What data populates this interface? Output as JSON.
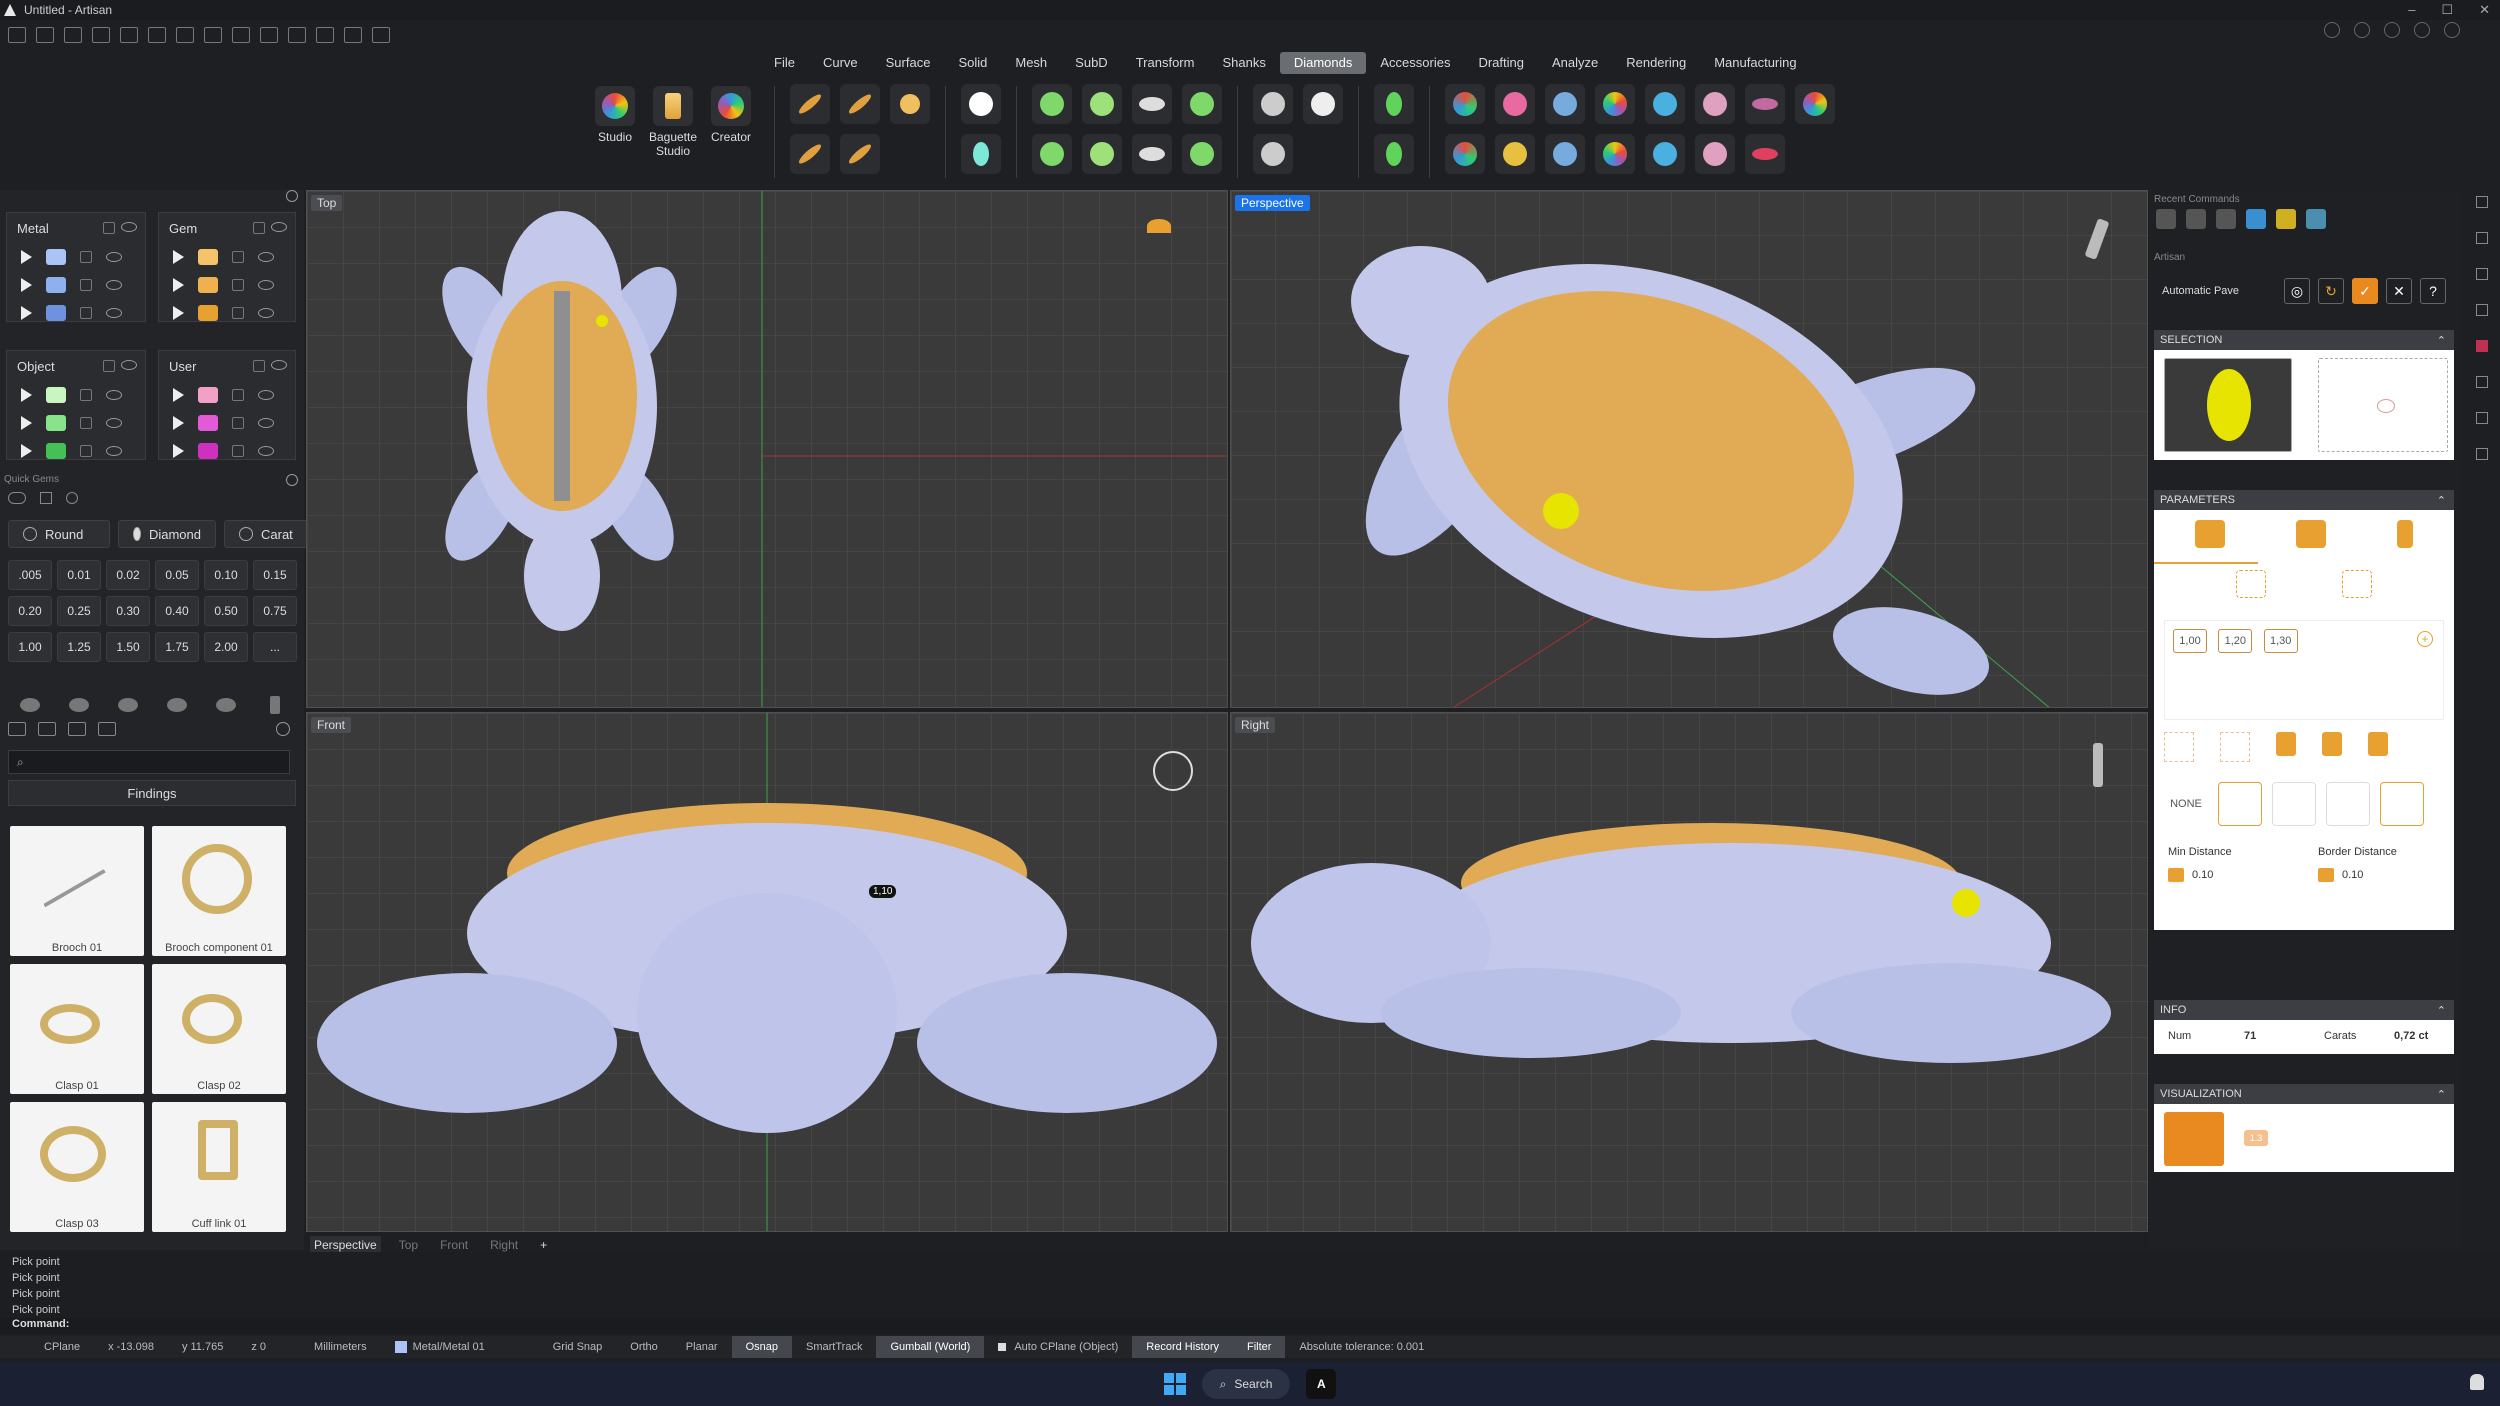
{
  "window": {
    "title": "Untitled - Artisan"
  },
  "menu": [
    "File",
    "Curve",
    "Surface",
    "Solid",
    "Mesh",
    "SubD",
    "Transform",
    "Shanks",
    "Diamonds",
    "Accessories",
    "Drafting",
    "Analyze",
    "Rendering",
    "Manufacturing"
  ],
  "menu_active": "Diamonds",
  "ribbon": {
    "studio": "Studio",
    "baguette": "Baguette Studio",
    "creator": "Creator"
  },
  "layers": {
    "metal": "Metal",
    "gem": "Gem",
    "object": "Object",
    "user": "User",
    "metal_colors": [
      "#a9c4f5",
      "#8fb0ef",
      "#6d92e0"
    ],
    "gem_colors": [
      "#f4c36a",
      "#f0b050",
      "#e8a030"
    ],
    "object_colors": [
      "#c9f5c0",
      "#88e38a",
      "#44c057"
    ],
    "user_colors": [
      "#f3a0c8",
      "#e35ad8",
      "#d030c0"
    ]
  },
  "quick_gems": {
    "title": "Quick Gems",
    "shape": "Round",
    "material": "Diamond",
    "unit": "Carat",
    "values": [
      ".005",
      "0.01",
      "0.02",
      "0.05",
      "0.10",
      "0.15",
      "0.20",
      "0.25",
      "0.30",
      "0.40",
      "0.50",
      "0.75",
      "1.00",
      "1.25",
      "1.50",
      "1.75",
      "2.00",
      "..."
    ]
  },
  "library": {
    "category": "Findings",
    "items": [
      "Brooch 01",
      "Brooch component 01",
      "Clasp 01",
      "Clasp 02",
      "Clasp 03",
      "Cuff link 01"
    ]
  },
  "viewports": {
    "top": "Top",
    "perspective": "Perspective",
    "front": "Front",
    "right": "Right"
  },
  "viewport_tabs": [
    "Perspective",
    "Top",
    "Front",
    "Right",
    "+"
  ],
  "front_label": "1,10",
  "command_history": [
    "Pick point",
    "Pick point",
    "Pick point",
    "Pick point"
  ],
  "command_prompt": "Command:",
  "status": {
    "cplane": "CPlane",
    "x": "x -13.098",
    "y": "y 11.765",
    "z": "z 0",
    "units": "Millimeters",
    "layer": "Metal/Metal 01",
    "grid_snap": "Grid Snap",
    "ortho": "Ortho",
    "planar": "Planar",
    "osnap": "Osnap",
    "smarttrack": "SmartTrack",
    "gumball": "Gumball (World)",
    "autocplane": "Auto CPlane (Object)",
    "record": "Record History",
    "filter": "Filter",
    "tolerance": "Absolute tolerance: 0.001"
  },
  "taskbar": {
    "search": "Search"
  },
  "right_panel": {
    "recent": "Recent Commands",
    "artisan": "Artisan",
    "tool": "Automatic Pave",
    "selection": "SELECTION",
    "parameters": "PARAMETERS",
    "sizes": [
      "1,00",
      "1,20",
      "1,30"
    ],
    "none": "NONE",
    "min_distance_label": "Min Distance",
    "min_distance": "0.10",
    "border_distance_label": "Border Distance",
    "border_distance": "0.10",
    "info": "INFO",
    "num_label": "Num",
    "num": "71",
    "carats_label": "Carats",
    "carats": "0,72 ct",
    "visualization": "VISUALIZATION",
    "vis_value": "1.3"
  }
}
